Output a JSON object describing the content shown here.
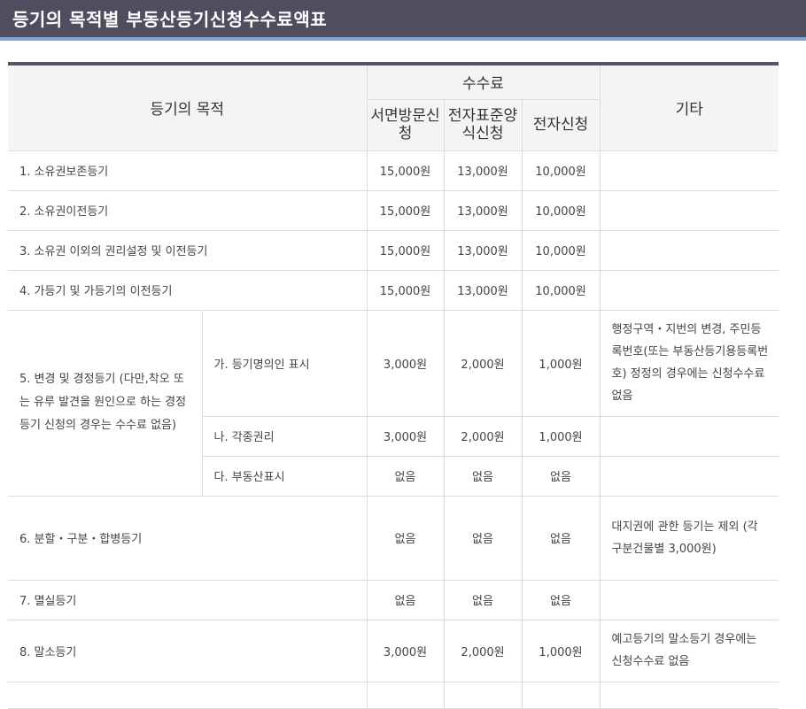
{
  "title": "등기의 목적별 부동산등기신청수수료액표",
  "headers": {
    "purpose": "등기의 목적",
    "fee": "수수료",
    "visit": "서면방문신청",
    "efile": "전자표준양식신청",
    "electronic": "전자신청",
    "etc": "기타"
  },
  "rows": {
    "r1": {
      "purpose": "1. 소유권보존등기",
      "visit": "15,000원",
      "efile": "13,000원",
      "electronic": "10,000원",
      "etc": ""
    },
    "r2": {
      "purpose": "2. 소유권이전등기",
      "visit": "15,000원",
      "efile": "13,000원",
      "electronic": "10,000원",
      "etc": ""
    },
    "r3": {
      "purpose": "3. 소유권 이외의 권리설정 및 이전등기",
      "visit": "15,000원",
      "efile": "13,000원",
      "electronic": "10,000원",
      "etc": ""
    },
    "r4": {
      "purpose": "4. 가등기 및 가등기의 이전등기",
      "visit": "15,000원",
      "efile": "13,000원",
      "electronic": "10,000원",
      "etc": ""
    },
    "r5": {
      "purpose": "5. 변경 및 경정등기 (다만,착오 또는 유루 발견을 원인으로 하는 경정 등기 신청의 경우는 수수료 없음)",
      "subs": [
        {
          "label": "가. 등기명의인 표시",
          "visit": "3,000원",
          "efile": "2,000원",
          "electronic": "1,000원",
          "etc": "행정구역・지번의 변경, 주민등록번호(또는 부동산등기용등록번호) 정정의 경우에는 신청수수료 없음"
        },
        {
          "label": "나. 각종권리",
          "visit": "3,000원",
          "efile": "2,000원",
          "electronic": "1,000원",
          "etc": ""
        },
        {
          "label": "다. 부동산표시",
          "visit": "없음",
          "efile": "없음",
          "electronic": "없음",
          "etc": ""
        }
      ]
    },
    "r6": {
      "purpose": "6. 분할・구분・합병등기",
      "visit": "없음",
      "efile": "없음",
      "electronic": "없음",
      "etc": "대지권에 관한 등기는 제외 (각 구분건물별 3,000원)"
    },
    "r7": {
      "purpose": "7. 멸실등기",
      "visit": "없음",
      "efile": "없음",
      "electronic": "없음",
      "etc": ""
    },
    "r8": {
      "purpose": "8. 말소등기",
      "visit": "3,000원",
      "efile": "2,000원",
      "electronic": "1,000원",
      "etc": "예고등기의 말소등기 경우에는 신청수수료 없음"
    }
  }
}
